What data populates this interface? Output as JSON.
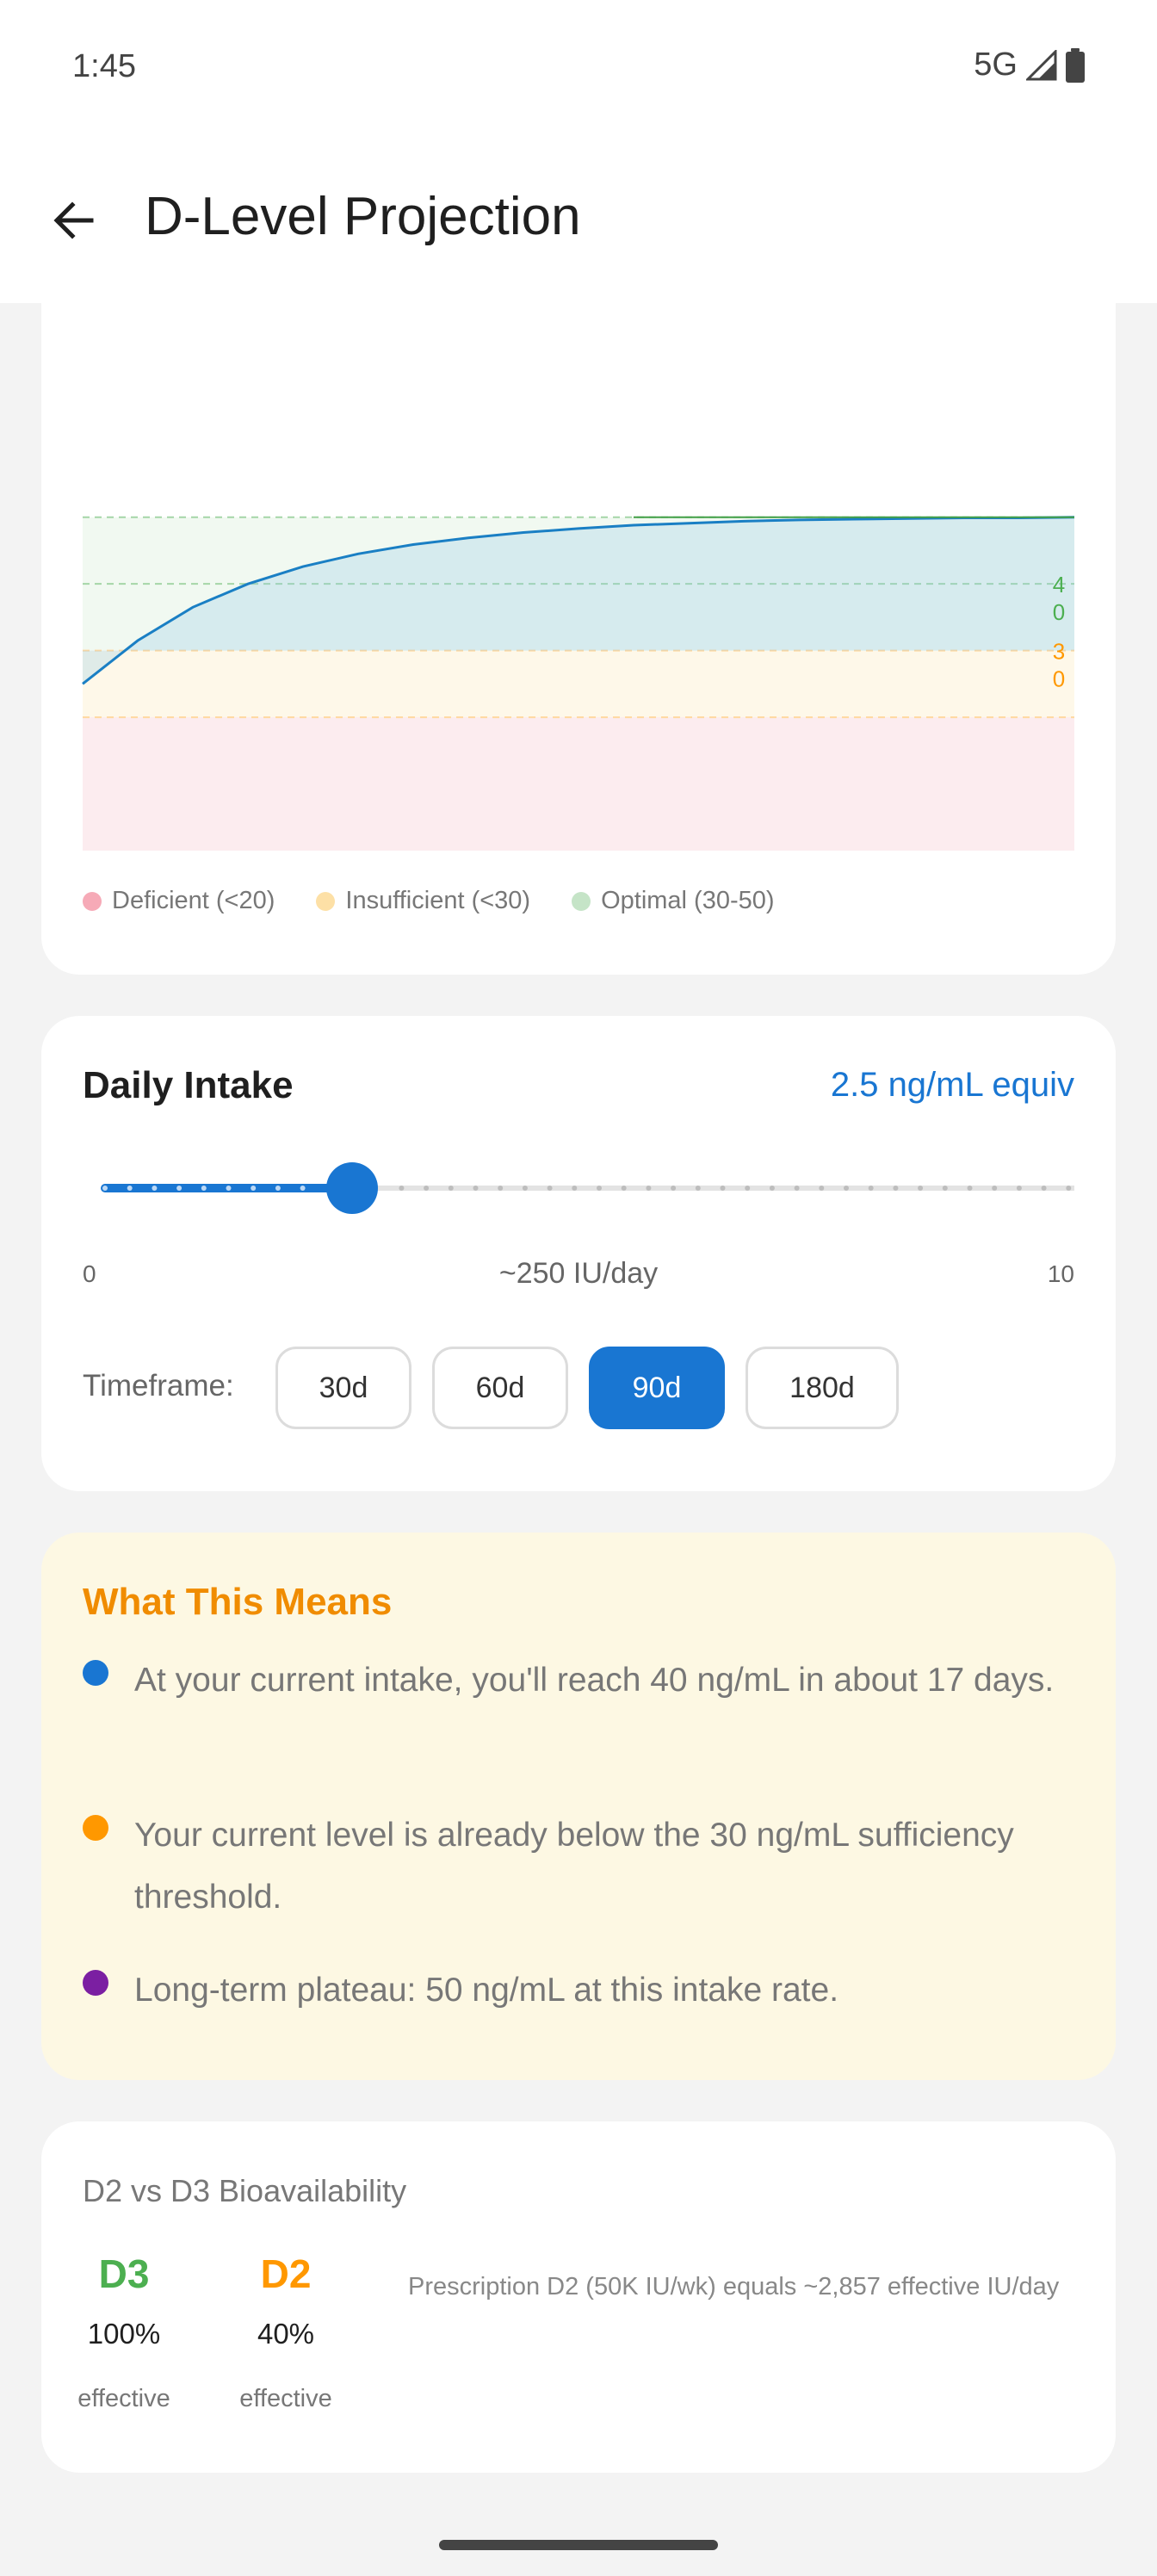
{
  "status_bar": {
    "time": "1:45",
    "network": "5G"
  },
  "app_bar": {
    "title": "D-Level Projection",
    "back_icon": "arrow-back-icon"
  },
  "chart_data": {
    "type": "area",
    "title": "",
    "xlabel": "",
    "ylabel": "",
    "ylim": [
      0,
      55
    ],
    "xlim": [
      0,
      90
    ],
    "grid": true,
    "zones": [
      {
        "name": "Deficient (<20)",
        "from": 0,
        "to": 20,
        "color": "#f5b3bf"
      },
      {
        "name": "Insufficient (<30)",
        "from": 20,
        "to": 30,
        "color": "#fde3a7"
      },
      {
        "name": "Optimal (30-50)",
        "from": 30,
        "to": 50,
        "color": "#c8e6c9"
      }
    ],
    "threshold_labels": [
      {
        "value": 40,
        "label": "4\n0",
        "color": "#4caf50"
      },
      {
        "value": 30,
        "label": "3\n0",
        "color": "#ff9800"
      }
    ],
    "series": [
      {
        "x": [
          0,
          5,
          10,
          15,
          20,
          25,
          30,
          35,
          40,
          45,
          50,
          55,
          60,
          65,
          70,
          75,
          80,
          85,
          90
        ],
        "values": [
          25,
          31.5,
          36.5,
          40.0,
          42.6,
          44.5,
          45.9,
          46.9,
          47.7,
          48.3,
          48.8,
          49.1,
          49.4,
          49.6,
          49.7,
          49.8,
          49.9,
          49.9,
          50.0
        ],
        "color": "#1a7fc4"
      }
    ]
  },
  "legend": [
    {
      "label": "Deficient (<20)",
      "color": "#f6aab7"
    },
    {
      "label": "Insufficient (<30)",
      "color": "#fde0a6"
    },
    {
      "label": "Optimal (30-50)",
      "color": "#c5e4c7"
    }
  ],
  "intake": {
    "title": "Daily Intake",
    "value_label": "2.5 ng/mL equiv",
    "slider_value": 2.5,
    "slider_min_label": "0",
    "slider_max_label": "10",
    "slider_caption": "~250 IU/day",
    "timeframe_label": "Timeframe:",
    "timeframes": [
      "30d",
      "60d",
      "90d",
      "180d"
    ],
    "selected_timeframe": "90d",
    "accent_color": "#1976d2"
  },
  "means": {
    "title": "What This Means",
    "items": [
      {
        "text": "At your current intake, you'll reach 40 ng/mL in about 17 days.",
        "color": "#1976d2"
      },
      {
        "text": "Your current level is already below the 30 ng/mL sufficiency threshold.",
        "color": "#ff9800"
      },
      {
        "text": "Long-term plateau: 50 ng/mL at this intake rate.",
        "color": "#7b1fa2"
      }
    ]
  },
  "bioavailability": {
    "title": "D2 vs D3 Bioavailability",
    "d3": {
      "name": "D3",
      "pct": "100%",
      "caption": "effective",
      "color": "#4caf50"
    },
    "d2": {
      "name": "D2",
      "pct": "40%",
      "caption": "effective",
      "color": "#ff9800"
    },
    "note": "Prescription D2 (50K IU/wk) equals ~2,857 effective IU/day"
  }
}
